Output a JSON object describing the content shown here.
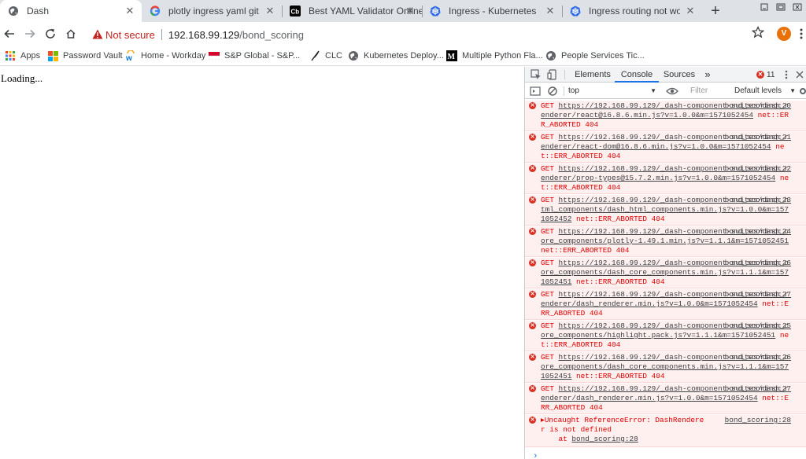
{
  "tabs": [
    {
      "label": "Dash",
      "icon": "globe-icon",
      "active": true
    },
    {
      "label": "plotly ingress yaml git - Goo",
      "icon": "google-icon",
      "active": false
    },
    {
      "label": "Best YAML Validator Online",
      "icon": "cb-icon",
      "active": false
    },
    {
      "label": "Ingress - Kubernetes",
      "icon": "kubernetes-icon",
      "active": false
    },
    {
      "label": "Ingress routing not working",
      "icon": "kubernetes-icon",
      "active": false
    }
  ],
  "toolbar": {
    "security_label": "Not secure",
    "url_host": "192.168.99.129",
    "url_path": "/bond_scoring",
    "avatar_letter": "V"
  },
  "bookmarks": [
    {
      "label": "Apps",
      "icon": "apps-grid-icon"
    },
    {
      "label": "Password Vault",
      "icon": "windows-logo-icon"
    },
    {
      "label": "Home - Workday",
      "icon": "workday-icon"
    },
    {
      "label": "S&P Global - S&P...",
      "icon": "sp-global-icon"
    },
    {
      "label": "CLC",
      "icon": "feather-icon"
    },
    {
      "label": "Kubernetes Deploy...",
      "icon": "globe-icon"
    },
    {
      "label": "Multiple Python Fla...",
      "icon": "medium-icon"
    },
    {
      "label": "People Services Tic...",
      "icon": "globe-icon"
    }
  ],
  "page": {
    "loading_text": "Loading..."
  },
  "devtools": {
    "tabs": [
      "Elements",
      "Console",
      "Sources"
    ],
    "active_tab": "Console",
    "more_tabs": "»",
    "error_count": "11",
    "context": "top",
    "filter_placeholder": "Filter",
    "levels": "Default levels",
    "messages": [
      {
        "prefix": "GET ",
        "url": "https://192.168.99.129/_dash-component-suites/dash_renderer/react@16.8.6.min.js?v=1.0.0&m=1571052454",
        "status": " net::ERR_ABORTED 404",
        "source": "bond_scoring:20"
      },
      {
        "prefix": "GET ",
        "url": "https://192.168.99.129/_dash-component-suites/dash_renderer/react-dom@16.8.6.min.js?v=1.0.0&m=1571052454",
        "status": " net::ERR_ABORTED 404",
        "source": "bond_scoring:21"
      },
      {
        "prefix": "GET ",
        "url": "https://192.168.99.129/_dash-component-suites/dash_renderer/prop-types@15.7.2.min.js?v=1.0.0&m=1571052454",
        "status": " net::ERR_ABORTED 404",
        "source": "bond_scoring:22"
      },
      {
        "prefix": "GET ",
        "url": "https://192.168.99.129/_dash-component-suites/dash_html_components/dash_html_components.min.js?v=1.0.0&m=1571052452",
        "status": " net::ERR_ABORTED 404",
        "source": "bond_scoring:23"
      },
      {
        "prefix": "GET ",
        "url": "https://192.168.99.129/_dash-component-suites/dash_core_components/plotly-1.49.1.min.js?v=1.1.1&m=1571052451",
        "status": " net::ERR_ABORTED 404",
        "source": "bond_scoring:24"
      },
      {
        "prefix": "GET ",
        "url": "https://192.168.99.129/_dash-component-suites/dash_core_components/dash_core_components.min.js?v=1.1.1&m=1571052451",
        "status": " net::ERR_ABORTED 404",
        "source": "bond_scoring:26"
      },
      {
        "prefix": "GET ",
        "url": "https://192.168.99.129/_dash-component-suites/dash_renderer/dash_renderer.min.js?v=1.0.0&m=1571052454",
        "status": " net::ERR_ABORTED 404",
        "source": "bond_scoring:27"
      },
      {
        "prefix": "GET ",
        "url": "https://192.168.99.129/_dash-component-suites/dash_core_components/highlight.pack.js?v=1.1.1&m=1571052451",
        "status": " net::ERR_ABORTED 404",
        "source": "bond_scoring:25"
      },
      {
        "prefix": "GET ",
        "url": "https://192.168.99.129/_dash-component-suites/dash_core_components/dash_core_components.min.js?v=1.1.1&m=1571052451",
        "status": " net::ERR_ABORTED 404",
        "source": "bond_scoring:26"
      },
      {
        "prefix": "GET ",
        "url": "https://192.168.99.129/_dash-component-suites/dash_renderer/dash_renderer.min.js?v=1.0.0&m=1571052454",
        "status": " net::ERR_ABORTED 404",
        "source": "bond_scoring:27"
      }
    ],
    "uncaught": {
      "text": "▸Uncaught ReferenceError: DashRenderer is not defined",
      "at_text": "    at ",
      "at_link": "bond_scoring:28",
      "source": "bond_scoring:28"
    },
    "prompt": "›"
  },
  "colors": {
    "accent": "#1a73e8",
    "error_red": "#e10000",
    "error_bg": "#fff0f0",
    "not_secure": "#c5221f",
    "avatar": "#e8710a"
  }
}
